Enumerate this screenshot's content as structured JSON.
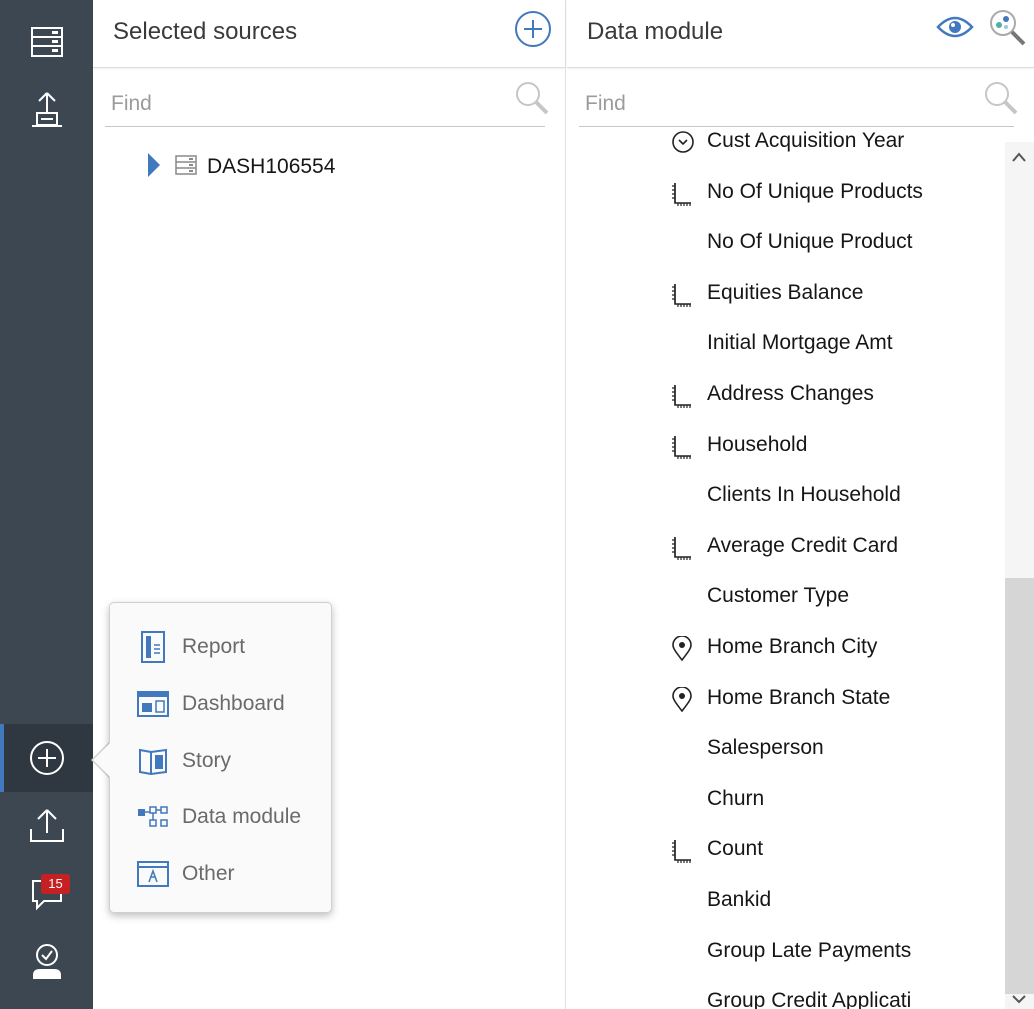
{
  "rail": {
    "items": [
      {
        "name": "data-server-icon"
      },
      {
        "name": "upload-data-icon"
      },
      {
        "name": "new-icon"
      },
      {
        "name": "upload-icon"
      },
      {
        "name": "notifications-icon"
      },
      {
        "name": "my-work-icon"
      }
    ],
    "notification_count": "15",
    "accent_color": "#4178be"
  },
  "sources_panel": {
    "title": "Selected sources",
    "find_placeholder": "Find",
    "tree": [
      {
        "label": "DASH106554",
        "icon": "database-icon",
        "expanded": false
      }
    ]
  },
  "data_module_panel": {
    "title": "Data module",
    "find_placeholder": "Find",
    "items": [
      {
        "label": "Cust Acquisition Year",
        "icon": "time-icon"
      },
      {
        "label": "No Of Unique Products",
        "icon": "measure-icon"
      },
      {
        "label": "No Of Unique Product",
        "icon": ""
      },
      {
        "label": "Equities Balance",
        "icon": "measure-icon"
      },
      {
        "label": "Initial Mortgage Amt",
        "icon": ""
      },
      {
        "label": "Address Changes",
        "icon": "measure-icon"
      },
      {
        "label": "Household",
        "icon": "measure-icon"
      },
      {
        "label": "Clients In Household",
        "icon": ""
      },
      {
        "label": "Average Credit Card",
        "icon": "measure-icon"
      },
      {
        "label": "Customer Type",
        "icon": ""
      },
      {
        "label": "Home Branch City",
        "icon": "location-icon"
      },
      {
        "label": "Home Branch State",
        "icon": "location-icon"
      },
      {
        "label": "Salesperson",
        "icon": ""
      },
      {
        "label": "Churn",
        "icon": ""
      },
      {
        "label": "Count",
        "icon": "measure-icon"
      },
      {
        "label": "Bankid",
        "icon": ""
      },
      {
        "label": "Group Late Payments",
        "icon": ""
      },
      {
        "label": "Group Credit Applicati",
        "icon": ""
      }
    ]
  },
  "new_menu": {
    "items": [
      {
        "label": "Report",
        "icon": "report-icon"
      },
      {
        "label": "Dashboard",
        "icon": "dashboard-icon"
      },
      {
        "label": "Story",
        "icon": "story-icon"
      },
      {
        "label": "Data module",
        "icon": "data-module-icon"
      },
      {
        "label": "Other",
        "icon": "other-icon"
      }
    ]
  }
}
